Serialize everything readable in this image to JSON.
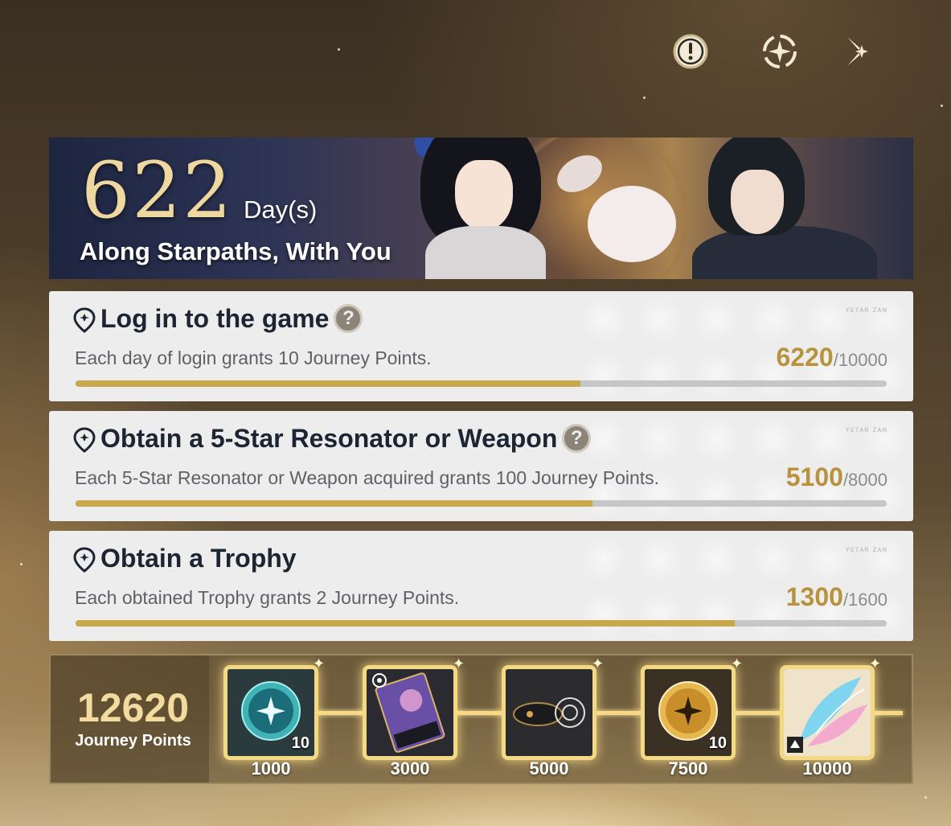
{
  "header": {
    "icons": [
      "info-icon",
      "compass-star-icon",
      "close-icon"
    ]
  },
  "banner": {
    "days_count": "622",
    "days_unit": "Day(s)",
    "subtitle": "Along Starpaths, With You"
  },
  "tasks": [
    {
      "title": "Log in to the game",
      "has_help": true,
      "description": "Each day of login grants 10 Journey Points.",
      "current": "6220",
      "max": "/10000",
      "progress_fraction": 0.622
    },
    {
      "title": "Obtain a 5-Star Resonator or Weapon",
      "has_help": true,
      "description": "Each 5-Star Resonator or Weapon acquired grants 100 Journey Points.",
      "current": "5100",
      "max": "/8000",
      "progress_fraction": 0.6375
    },
    {
      "title": "Obtain a Trophy",
      "has_help": false,
      "description": "Each obtained Trophy grants 2 Journey Points.",
      "current": "1300",
      "max": "/1600",
      "progress_fraction": 0.8125
    }
  ],
  "summary": {
    "points": "12620",
    "label": "Journey Points"
  },
  "rewards": [
    {
      "cost": "1000",
      "quantity": "10",
      "icon": "teal-orb-icon"
    },
    {
      "cost": "3000",
      "quantity": "",
      "icon": "card-art-icon"
    },
    {
      "cost": "5000",
      "quantity": "",
      "icon": "gadget-icon"
    },
    {
      "cost": "7500",
      "quantity": "10",
      "icon": "gold-orb-icon"
    },
    {
      "cost": "10000",
      "quantity": "",
      "icon": "wings-icon"
    }
  ],
  "colors": {
    "accent_gold": "#c9a84b",
    "progress_value": "#b8923d",
    "card_bg": "#ededed",
    "title_text": "#1d2533"
  }
}
